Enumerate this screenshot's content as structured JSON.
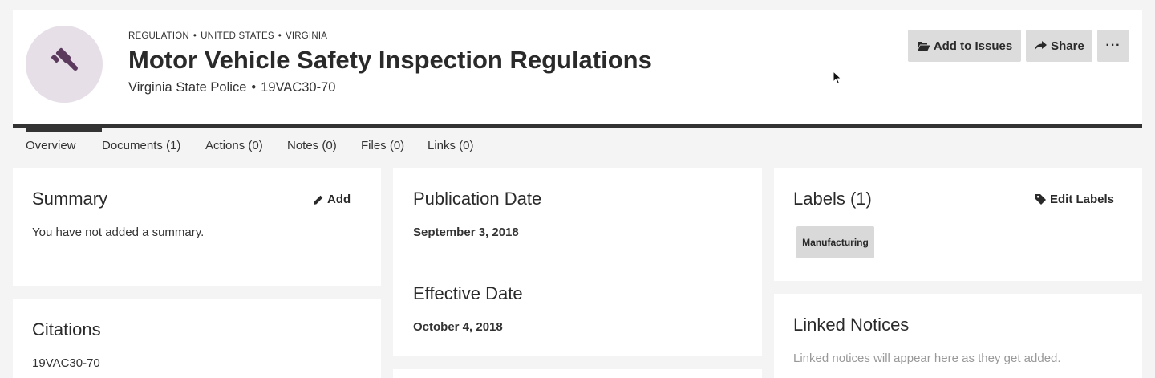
{
  "header": {
    "breadcrumb": [
      "REGULATION",
      "UNITED STATES",
      "VIRGINIA"
    ],
    "breadcrumb_separator": "•",
    "title": "Motor Vehicle Safety Inspection Regulations",
    "agency": "Virginia State Police",
    "code": "19VAC30-70",
    "subtitle_separator": "•",
    "avatar_icon": "gavel-icon",
    "avatar_color": "#5b3a5e",
    "buttons": {
      "add_to_issues": "Add to Issues",
      "share": "Share",
      "more": "···"
    }
  },
  "tabs": [
    {
      "label": "Overview",
      "active": true
    },
    {
      "label": "Documents (1)"
    },
    {
      "label": "Actions (0)"
    },
    {
      "label": "Notes (0)"
    },
    {
      "label": "Files (0)"
    },
    {
      "label": "Links (0)"
    }
  ],
  "summary": {
    "title": "Summary",
    "action": "Add",
    "text": "You have not added a summary."
  },
  "citations": {
    "title": "Citations",
    "items": [
      "19VAC30-70"
    ]
  },
  "dates": {
    "publication_title": "Publication Date",
    "publication_value": "September 3, 2018",
    "effective_title": "Effective Date",
    "effective_value": "October 4, 2018"
  },
  "labels": {
    "title": "Labels (1)",
    "action": "Edit Labels",
    "items": [
      "Manufacturing"
    ]
  },
  "linked_notices": {
    "title": "Linked Notices",
    "empty_text": "Linked notices will appear here as they get added."
  }
}
